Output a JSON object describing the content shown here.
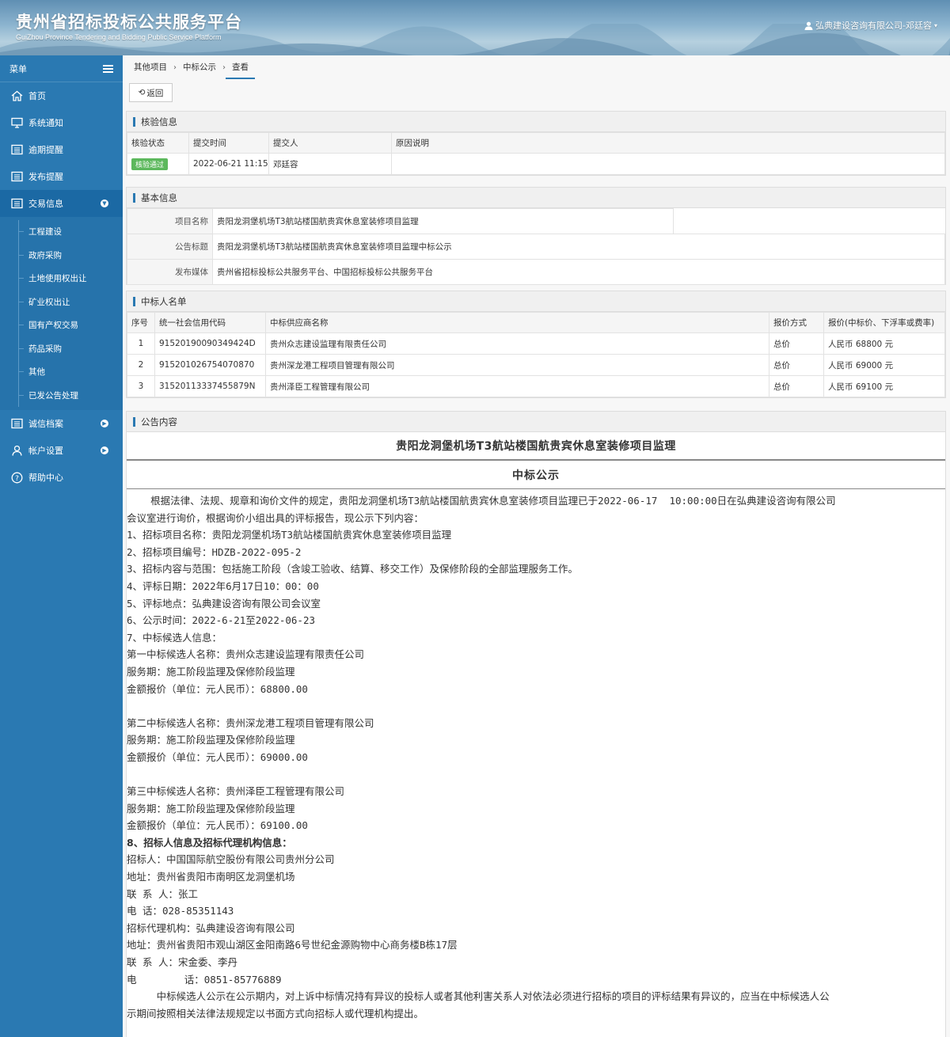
{
  "header": {
    "title": "贵州省招标投标公共服务平台",
    "subtitle": "GuiZhou Province Tendering and Bidding Public Service Platform",
    "user": "弘典建设咨询有限公司-邓廷容"
  },
  "sidebar": {
    "menu_label": "菜单",
    "items": [
      {
        "label": "首页",
        "icon": "home-icon"
      },
      {
        "label": "系统通知",
        "icon": "monitor-icon"
      },
      {
        "label": "逾期提醒",
        "icon": "list-icon"
      },
      {
        "label": "发布提醒",
        "icon": "list-icon"
      },
      {
        "label": "交易信息",
        "icon": "list-icon"
      }
    ],
    "sub_items": [
      "工程建设",
      "政府采购",
      "土地使用权出让",
      "矿业权出让",
      "国有产权交易",
      "药品采购",
      "其他",
      "已发公告处理"
    ],
    "bottom_items": [
      {
        "label": "诚信档案",
        "icon": "list-icon"
      },
      {
        "label": "帐户设置",
        "icon": "user-icon"
      },
      {
        "label": "帮助中心",
        "icon": "help-icon"
      }
    ]
  },
  "breadcrumb": [
    "其他项目",
    "中标公示",
    "查看"
  ],
  "back_label": "返回",
  "verify": {
    "title": "核验信息",
    "headers": [
      "核验状态",
      "提交时间",
      "提交人",
      "原因说明"
    ],
    "status": "核验通过",
    "time": "2022-06-21 11:15",
    "person": "邓廷容",
    "reason": ""
  },
  "basic": {
    "title": "基本信息",
    "rows": [
      {
        "k": "项目名称",
        "v": "贵阳龙洞堡机场T3航站楼国航贵宾休息室装修项目监理"
      },
      {
        "k": "公告标题",
        "v": "贵阳龙洞堡机场T3航站楼国航贵宾休息室装修项目监理中标公示"
      },
      {
        "k": "发布媒体",
        "v": "贵州省招标投标公共服务平台、中国招标投标公共服务平台"
      }
    ]
  },
  "winners": {
    "title": "中标人名单",
    "headers": [
      "序号",
      "统一社会信用代码",
      "中标供应商名称",
      "报价方式",
      "报价(中标价、下浮率或费率)"
    ],
    "rows": [
      [
        "1",
        "91520190090349424D",
        "贵州众志建设监理有限责任公司",
        "总价",
        "人民币 68800 元"
      ],
      [
        "2",
        "915201026754070870",
        "贵州深龙港工程项目管理有限公司",
        "总价",
        "人民币 69000 元"
      ],
      [
        "3",
        "31520113337455879N",
        "贵州泽臣工程管理有限公司",
        "总价",
        "人民币 69100 元"
      ]
    ]
  },
  "announcement": {
    "title": "公告内容",
    "heading": "贵阳龙洞堡机场T3航站楼国航贵宾休息室装修项目监理",
    "subheading": "中标公示",
    "lines": [
      "    根据法律、法规、规章和询价文件的规定，贵阳龙洞堡机场T3航站楼国航贵宾休息室装修项目监理已于2022-06-17  10:00:00日在弘典建设咨询有限公司",
      "会议室进行询价，根据询价小组出具的评标报告，现公示下列内容：",
      "1、招标项目名称：贵阳龙洞堡机场T3航站楼国航贵宾休息室装修项目监理",
      "2、招标项目编号：HDZB-2022-095-2",
      "3、招标内容与范围：包括施工阶段（含竣工验收、结算、移交工作）及保修阶段的全部监理服务工作。",
      "4、评标日期：2022年6月17日10：00：00",
      "5、评标地点：弘典建设咨询有限公司会议室",
      "6、公示时间：2022-6-21至2022-06-23",
      "7、中标候选人信息：",
      "第一中标候选人名称：贵州众志建设监理有限责任公司",
      "服务期：施工阶段监理及保修阶段监理",
      "金额报价（单位：元人民币）：68800.00",
      "",
      "第二中标候选人名称：贵州深龙港工程项目管理有限公司",
      "服务期：施工阶段监理及保修阶段监理",
      "金额报价（单位：元人民币）：69000.00",
      "",
      "第三中标候选人名称：贵州泽臣工程管理有限公司",
      "服务期：施工阶段监理及保修阶段监理",
      "金额报价（单位：元人民币）：69100.00",
      "8、招标人信息及招标代理机构信息：",
      "招标人：中国国际航空股份有限公司贵州分公司",
      "地址：贵州省贵阳市南明区龙洞堡机场",
      "联 系 人：张工",
      "电 话：028-85351143",
      "招标代理机构：弘典建设咨询有限公司",
      "地址：贵州省贵阳市观山湖区金阳南路6号世纪金源购物中心商务楼B栋17层",
      "联 系 人：宋金委、李丹",
      "电        话：0851-85776889",
      "     中标候选人公示在公示期内，对上诉中标情况持有异议的投标人或者其他利害关系人对依法必须进行招标的项目的评标结果有异议的，应当在中标候选人公",
      "示期间按照相关法律法规规定以书面方式向招标人或代理机构提出。"
    ]
  }
}
